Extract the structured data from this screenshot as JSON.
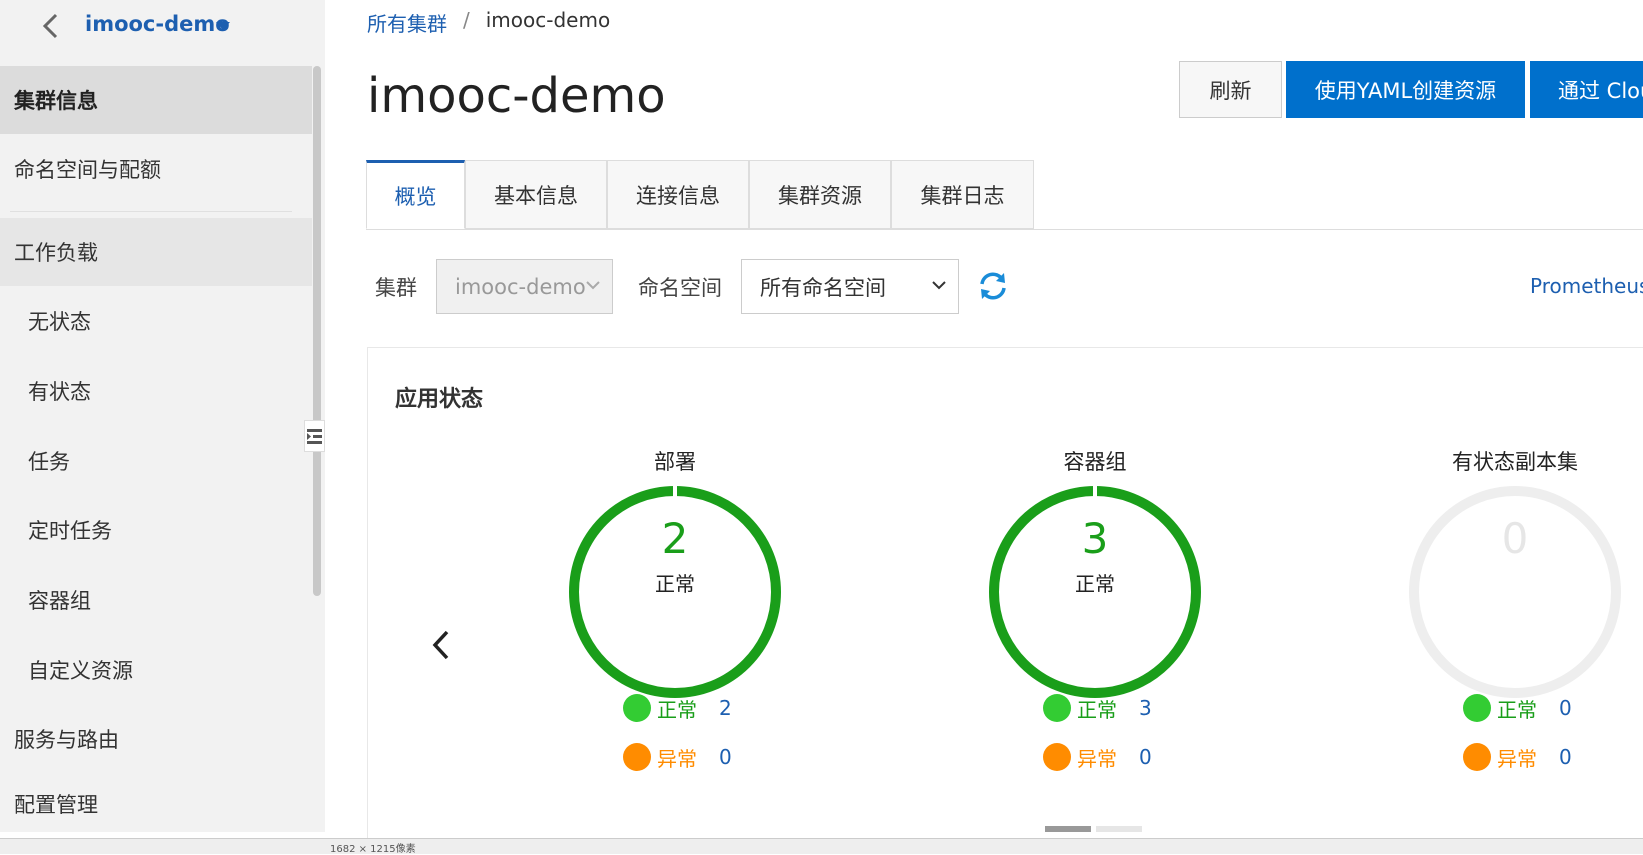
{
  "sidebar": {
    "cluster_name": "imooc-demo",
    "items": [
      {
        "label": "集群信息"
      },
      {
        "label": "命名空间与配额"
      },
      {
        "label": "工作负载"
      },
      {
        "label": "无状态"
      },
      {
        "label": "有状态"
      },
      {
        "label": "任务"
      },
      {
        "label": "定时任务"
      },
      {
        "label": "容器组"
      },
      {
        "label": "自定义资源"
      },
      {
        "label": "服务与路由"
      },
      {
        "label": "配置管理"
      }
    ]
  },
  "breadcrumb": {
    "root": "所有集群",
    "separator": "/",
    "current": "imooc-demo"
  },
  "page_title": "imooc-demo",
  "header_buttons": {
    "refresh": "刷新",
    "yaml": "使用YAML创建资源",
    "cloud": "通过 Clou"
  },
  "tabs": [
    {
      "label": "概览"
    },
    {
      "label": "基本信息"
    },
    {
      "label": "连接信息"
    },
    {
      "label": "集群资源"
    },
    {
      "label": "集群日志"
    }
  ],
  "filters": {
    "cluster_label": "集群",
    "cluster_value": "imooc-demo",
    "namespace_label": "命名空间",
    "namespace_value": "所有命名空间",
    "prometheus": "Prometheus"
  },
  "app_status": {
    "title": "应用状态",
    "cards": [
      {
        "title": "部署",
        "total": "2",
        "total_label": "正常",
        "normal_label": "正常",
        "normal": "2",
        "abnormal_label": "异常",
        "abnormal": "0"
      },
      {
        "title": "容器组",
        "total": "3",
        "total_label": "正常",
        "normal_label": "正常",
        "normal": "3",
        "abnormal_label": "异常",
        "abnormal": "0"
      },
      {
        "title": "有状态副本集",
        "total": "0",
        "total_label": "",
        "normal_label": "正常",
        "normal": "0",
        "abnormal_label": "异常",
        "abnormal": "0"
      }
    ]
  },
  "bottom_bar": {
    "size_text": "1682 × 1215像素"
  },
  "colors": {
    "accent": "#1d5fb0",
    "primary_button": "#0070cc",
    "ok_green": "#1a9e1a",
    "ok_dot": "#33cc33",
    "warn_orange": "#ff8c00",
    "ring_empty": "#eeeeee"
  }
}
